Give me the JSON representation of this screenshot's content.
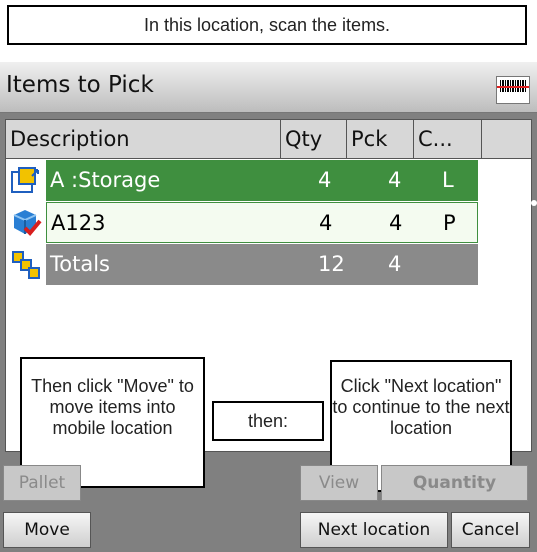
{
  "instruction_top": "In this location, scan the items.",
  "window": {
    "title": "Items to Pick",
    "scanner_icon": "barcode-scanner-icon"
  },
  "grid": {
    "columns": [
      "Description",
      "Qty",
      "Pck",
      "C..."
    ],
    "rows": [
      {
        "icon": "storage-location-icon",
        "description": "A :Storage",
        "qty": "4",
        "pck": "4",
        "c": "L"
      },
      {
        "icon": "item-box-check-icon",
        "description": "A123",
        "qty": "4",
        "pck": "4",
        "c": "P"
      },
      {
        "icon": "totals-icon",
        "description": "Totals",
        "qty": "12",
        "pck": "4",
        "c": ""
      }
    ]
  },
  "callouts": {
    "move": "Then click \"Move\" to move items into mobile location",
    "then": "then:",
    "next": "Click \"Next location\" to continue to the next location"
  },
  "buttons": {
    "pallet": "Pallet",
    "view": "View",
    "quantity": "Quantity",
    "move": "Move",
    "next_location": "Next location",
    "cancel": "Cancel"
  },
  "colors": {
    "selected_row": "#3f8f3f",
    "totals_row": "#8a8a8a",
    "window_bg": "#808080"
  }
}
